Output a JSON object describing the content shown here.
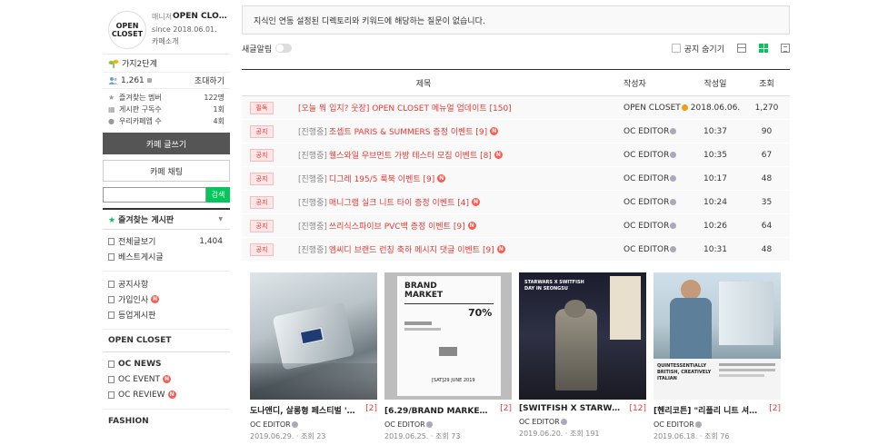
{
  "cafe": {
    "logo_line1": "OPEN",
    "logo_line2": "CLOSET",
    "manager_label": "매니저",
    "name": "OPEN CLOSET",
    "since": "since 2018.06.01.",
    "intro": "카페소개",
    "level": "가지2단계",
    "member_count": "1,261",
    "invite": "초대하기",
    "stats": [
      {
        "label": "즐겨찾는 멤버",
        "value": "122명"
      },
      {
        "label": "게시판 구독수",
        "value": "1회"
      },
      {
        "label": "우리카페앱 수",
        "value": "4회"
      }
    ],
    "write_button": "카페 글쓰기",
    "chat_button": "카페 채팅",
    "search_button": "검색",
    "search_value": "",
    "fav_header": "즐겨찾는 게시판",
    "menu_group1": [
      {
        "label": "전체글보기",
        "count": "1,404"
      },
      {
        "label": "베스트게시글",
        "count": ""
      }
    ],
    "menu_group2": [
      {
        "label": "공지사항",
        "new": false
      },
      {
        "label": "가입인사",
        "new": true
      },
      {
        "label": "등업게시판",
        "new": false
      }
    ],
    "section_open_closet": "OPEN CLOSET",
    "menu_group3": [
      {
        "label": "OC NEWS",
        "new": false
      },
      {
        "label": "OC EVENT",
        "new": true
      },
      {
        "label": "OC REVIEW",
        "new": true
      }
    ],
    "section_fashion": "FASHION",
    "new_badge": "N"
  },
  "main": {
    "notice": "지식인 연동 설정된 디렉토리와 키워드에 해당하는 질문이 없습니다.",
    "new_alert": "새글알림",
    "hide_notice": "공지 숨기기",
    "headers": {
      "title": "제목",
      "author": "작성자",
      "date": "작성일",
      "views": "조회"
    },
    "rows": [
      {
        "badge": "필독",
        "prefix": "",
        "title": "[오늘 뭐 입지? 웃장] OPEN CLOSET 메뉴얼 업데이트 [150]",
        "new": false,
        "author": "OPEN CLOSET",
        "date": "2018.06.06.",
        "views": "1,270"
      },
      {
        "badge": "공지",
        "prefix": "[진행중]",
        "title": "조셉트 PARIS & SUMMERS 증정 이벤트 [9]",
        "new": true,
        "author": "OC EDITOR",
        "date": "10:37",
        "views": "90"
      },
      {
        "badge": "공지",
        "prefix": "[진행중]",
        "title": "웰스와일 우브먼트 가방 테스터 모집 이벤트 [8]",
        "new": true,
        "author": "OC EDITOR",
        "date": "10:35",
        "views": "67"
      },
      {
        "badge": "공지",
        "prefix": "[진행중]",
        "title": "디그레 195/5 룩북 이벤트 [9]",
        "new": true,
        "author": "OC EDITOR",
        "date": "10:17",
        "views": "48"
      },
      {
        "badge": "공지",
        "prefix": "[진행중]",
        "title": "매니그램 실크 니트 타이 증정 이벤트 [4]",
        "new": true,
        "author": "OC EDITOR",
        "date": "10:24",
        "views": "35"
      },
      {
        "badge": "공지",
        "prefix": "[진행중]",
        "title": "쓰리식스파이브 PVC백 증정 이벤트 [9]",
        "new": true,
        "author": "OC EDITOR",
        "date": "10:26",
        "views": "64"
      },
      {
        "badge": "공지",
        "prefix": "[진행중]",
        "title": "엠씨디 브랜드 런칭 축하 메시지 댓글 이벤트 [9]",
        "new": true,
        "author": "OC EDITOR",
        "date": "10:31",
        "views": "48"
      }
    ],
    "cards": [
      {
        "title": "도나앤디, 살롱형 페스티벌 '크레…",
        "count": "[2]",
        "author": "OC EDITOR",
        "date": "2019.06.29.",
        "views": "· 조회 23"
      },
      {
        "title": "[6.29/BRAND MARKET] 월스…",
        "count": "[2]",
        "author": "OC EDITOR",
        "date": "2019.06.25.",
        "views": "· 조회 73",
        "thumb_text1": "BRAND",
        "thumb_text2": "MARKET",
        "thumb_text3": "70%",
        "thumb_text4": "[SAT]29 JUNE 2019"
      },
      {
        "title": "[SWITFISH X STARWARS…",
        "count": "[12]",
        "author": "OC EDITOR",
        "date": "2019.06.20.",
        "views": "· 조회 191",
        "thumb_text1": "STARWARS X SWITFISH",
        "thumb_text2": "DAY IN SEONGSU"
      },
      {
        "title": "[헨리코튼] \"리플리 니트 셔츠\" 기…",
        "count": "[2]",
        "author": "OC EDITOR",
        "date": "2019.06.18.",
        "views": "· 조회 76",
        "thumb_text1": "QUINTESSENTIALLY",
        "thumb_text2": "BRITISH, CREATIVELY",
        "thumb_text3": "ITALIAN"
      }
    ]
  }
}
